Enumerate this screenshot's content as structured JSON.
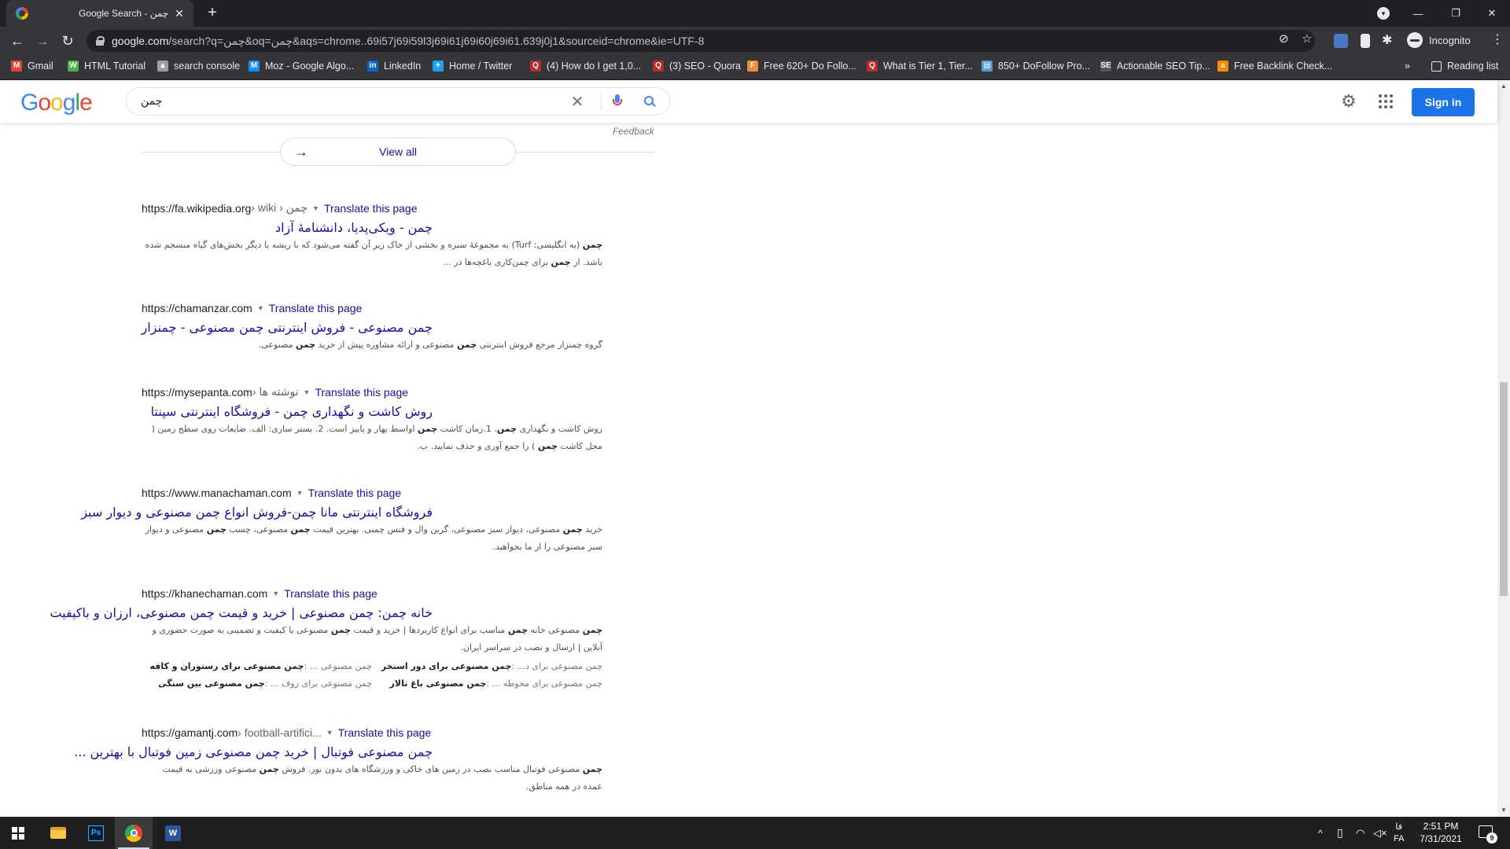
{
  "browser": {
    "tab": {
      "title": "Google Search - چمن",
      "close_glyph": "✕",
      "favicon": "google-favicon"
    },
    "new_tab_glyph": "+",
    "window_controls": {
      "minimize": "—",
      "maximize": "❐",
      "close": "✕"
    },
    "nav": {
      "back": "←",
      "forward": "→",
      "reload": "↻"
    },
    "url": {
      "host": "google.com",
      "path": "/search?q=چمن&oq=چمن&aqs=chrome..69i57j69i59l3j69i61j69i60j69i61.639j0j1&sourceid=chrome&ie=UTF-8"
    },
    "omnibox_icons": {
      "star": "☆"
    },
    "profile_label": "Incognito",
    "menu_glyph": "⋮"
  },
  "bookmarks": {
    "items": [
      {
        "label": "Gmail",
        "icon": "gmail-icon",
        "color": "#ea4335",
        "glyph": "M"
      },
      {
        "label": "HTML Tutorial",
        "icon": "w3schools-icon",
        "color": "#4caf50",
        "glyph": "W"
      },
      {
        "label": "search console",
        "icon": "search-console-icon",
        "color": "#9aa0a6",
        "glyph": "▲"
      },
      {
        "label": "Moz - Google Algo...",
        "icon": "moz-icon",
        "color": "#1a8cff",
        "glyph": "M"
      },
      {
        "label": "LinkedIn",
        "icon": "linkedin-icon",
        "color": "#0a66c2",
        "glyph": "in"
      },
      {
        "label": "Home / Twitter",
        "icon": "twitter-icon",
        "color": "#1da1f2",
        "glyph": "✦"
      },
      {
        "label": "(4) How do I get 1,0...",
        "icon": "quora-icon",
        "color": "#b92b27",
        "glyph": "Q"
      },
      {
        "label": "(3) SEO - Quora",
        "icon": "quora-icon",
        "color": "#b92b27",
        "glyph": "Q"
      },
      {
        "label": "Free 620+ Do Follo...",
        "icon": "site-icon",
        "color": "#f28b30",
        "glyph": "F"
      },
      {
        "label": "What is Tier 1, Tier...",
        "icon": "quora-icon",
        "color": "#b92b27",
        "glyph": "Q"
      },
      {
        "label": "850+ DoFollow Pro...",
        "icon": "site-icon",
        "color": "#5b9bd5",
        "glyph": "▤"
      },
      {
        "label": "Actionable SEO Tip...",
        "icon": "site-icon",
        "color": "#555555",
        "glyph": "SE"
      },
      {
        "label": "Free Backlink Check...",
        "icon": "ahrefs-icon",
        "color": "#ff8800",
        "glyph": "a"
      }
    ],
    "overflow_glyph": "»",
    "reading_list": "Reading list"
  },
  "google": {
    "logo": [
      "G",
      "o",
      "o",
      "g",
      "l",
      "e"
    ],
    "logo_colors": [
      "#4285f4",
      "#ea4335",
      "#fbbc05",
      "#4285f4",
      "#34a853",
      "#ea4335"
    ],
    "query": "چمن",
    "clear_glyph": "✕",
    "settings_glyph": "⚙",
    "sign_in": "Sign in"
  },
  "results_top": {
    "feedback": "Feedback",
    "view_all": "View all",
    "view_all_arrow": "→"
  },
  "results": [
    {
      "site": "https://fa.wikipedia.org",
      "crumb": " › wiki › چمن",
      "translate": "Translate this page",
      "title": "چمن - ویکی‌پدیا، دانشنامهٔ آزاد",
      "snippet_html": "<b>چمن</b> (به انگلیسی: Turf) به مجموعهٔ سبزه و بخشی از خاک زیر آن گفته می‌شود که با ریشه یا دیگر بخش‌های گیاه منسجم شده باشد. از <b>چمن</b> برای چمن‌کاری باغچه‌ها در ..."
    },
    {
      "site": "https://chamanzar.com",
      "crumb": "",
      "translate": "Translate this page",
      "title": "چمن مصنوعی - فروش اینترنتی چمن مصنوعی - چمنزار",
      "snippet_html": "گروه چمنزار مرجع فروش اینترنتی <b>چمن</b> مصنوعی و ارائه مشاوره پیش از خرید <b>چمن</b> مصنوعی."
    },
    {
      "site": "https://mysepanta.com",
      "crumb": " › نوشته ها",
      "translate": "Translate this page",
      "title": "روش کاشت و نگهداری چمن - فروشگاه اینترنتی سپنتا",
      "snippet_html": "روش کاشت و نگهداری <b>چمن</b>. 1.زمان کاشت <b>چمن</b> اواسط بهار و پاییز است. 2. بستر سازی: الف. ضایعات روی سطح زمین ( محل کاشت <b>چمن</b> ) را جمع آوری و حذف نمایید. ب."
    },
    {
      "site": "https://www.manachaman.com",
      "crumb": "",
      "translate": "Translate this page",
      "title": "فروشگاه اینترنتی مانا چمن-فروش انواع چمن مصنوعی و دیوار سبز",
      "snippet_html": "خرید <b>چمن</b> مصنوعی، دیوار سبز مصنوعی، گرین وال و فنس چمنی. بهترین قیمت <b>چمن</b> مصنوعی، چسب <b>چمن</b> مصنوعی و دیوار سبز مصنوعی را از ما بخواهید."
    },
    {
      "site": "https://khanechaman.com",
      "crumb": "",
      "translate": "Translate this page",
      "title": "خانه چمن: چمن مصنوعی | خرید و قیمت چمن مصنوعی، ارزان و باکیفیت",
      "snippet_html": "<b>چمن</b> مصنوعی خانه <b>چمن</b> مناسب برای انواع کاربردها | خرید و قیمت <b>چمن</b> مصنوعی با کیفیت و تضمینی به صورت حضوری و آنلاین | ارسال و نصب در سراسر ایران.",
      "sitelinks_html": [
        "چمن مصنوعی برای د... :<b>چمن مصنوعی برای دور استخر</b>",
        "چمن مصنوعی ... :<b>چمن مصنوعی برای رستوران و کافه</b>",
        "چمن مصنوعی برای محوطه ... :<b>چمن مصنوعی باغ تالار</b>",
        "چمن مصنوعی برای روف ... :<b>چمن مصنوعی بین سنگی</b>"
      ]
    },
    {
      "site": "https://gamantj.com",
      "crumb": " › football-artifici...",
      "translate": "Translate this page",
      "title": "چمن مصنوعی فوتبال | خرید چمن مصنوعی زمین فوتبال با بهترین ...",
      "snippet_html": "<b>چمن</b> مصنوعی فوتبال مناسب نصب در زمین های خاکی و ورزشگاه های بدون نور. فروش <b>چمن</b> مصنوعی ورزشی به قیمت عمده در همه مناطق."
    }
  ],
  "scrollbar": {
    "up": "▲",
    "down": "▼"
  },
  "taskbar": {
    "apps": [
      {
        "name": "file-explorer",
        "active": false
      },
      {
        "name": "photoshop",
        "label": "Ps",
        "active": false
      },
      {
        "name": "chrome",
        "active": true
      },
      {
        "name": "word",
        "label": "W",
        "active": false
      }
    ],
    "tray": {
      "chevron": "^",
      "lang_top": "فا",
      "lang_bottom": "FA"
    },
    "time": "2:51 PM",
    "date": "7/31/2021",
    "notification_count": "9"
  }
}
